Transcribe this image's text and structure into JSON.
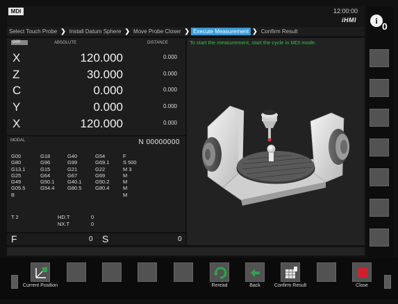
{
  "header": {
    "mode": "MDI",
    "clock": "12:00:00",
    "brand": "iHMI"
  },
  "info": {
    "count": "0"
  },
  "breadcrumbs": [
    {
      "label": "Select Touch Probe",
      "active": false
    },
    {
      "label": "Install Datum Sphere",
      "active": false
    },
    {
      "label": "Move Probe Closer",
      "active": false
    },
    {
      "label": "Execute Measurement",
      "active": true
    },
    {
      "label": "Confirm Result",
      "active": false
    }
  ],
  "positions": {
    "gcode": "G00",
    "absolute_label": "ABSOLUTE",
    "distance_label": "DISTANCE",
    "axes": [
      {
        "letter": "X",
        "value": "120.000",
        "distance": "0.000"
      },
      {
        "letter": "Z",
        "value": "30.000",
        "distance": "0.000"
      },
      {
        "letter": "C",
        "value": "0.000",
        "distance": "0.000"
      },
      {
        "letter": "Y",
        "value": "0.000",
        "distance": "0.000"
      },
      {
        "letter": "X",
        "value": "120.000",
        "distance": "0.000"
      }
    ]
  },
  "modal": {
    "title": "MODAL",
    "program": "N 00000000",
    "col1": [
      "G00",
      "G80",
      "G13.1",
      "G25",
      "G49",
      "G05.5",
      "B"
    ],
    "col2": [
      "G18",
      "G96",
      "G15",
      "G64",
      "G50.1",
      "G54.4"
    ],
    "col3": [
      "G40",
      "G99",
      "G21",
      "G67",
      "G40.1",
      "G80.5"
    ],
    "col4": [
      "G54",
      "G69.1",
      "G22",
      "G69",
      "G50.2",
      "G80.4"
    ],
    "col5": [
      "F",
      "S  500",
      "M 3",
      "M",
      "M",
      "M",
      "M"
    ],
    "tool": "T 2",
    "hd_label": "HD.T",
    "hd_value": "0",
    "nx_label": "NX.T",
    "nx_value": "0"
  },
  "feed_speed": {
    "f_label": "F",
    "f_value": "0",
    "s_label": "S",
    "s_value": "0"
  },
  "instruction": "To start the measurement, start the cycle in MDI mode.",
  "softkeys": {
    "current_position": "Current Position",
    "reread": "Reread",
    "back": "Back",
    "confirm_result": "Confirm Result",
    "close": "Close"
  },
  "colors": {
    "accent": "#3a9ad8",
    "instruction": "#35c24a",
    "close": "#d0202e",
    "reread": "#27a24a"
  }
}
